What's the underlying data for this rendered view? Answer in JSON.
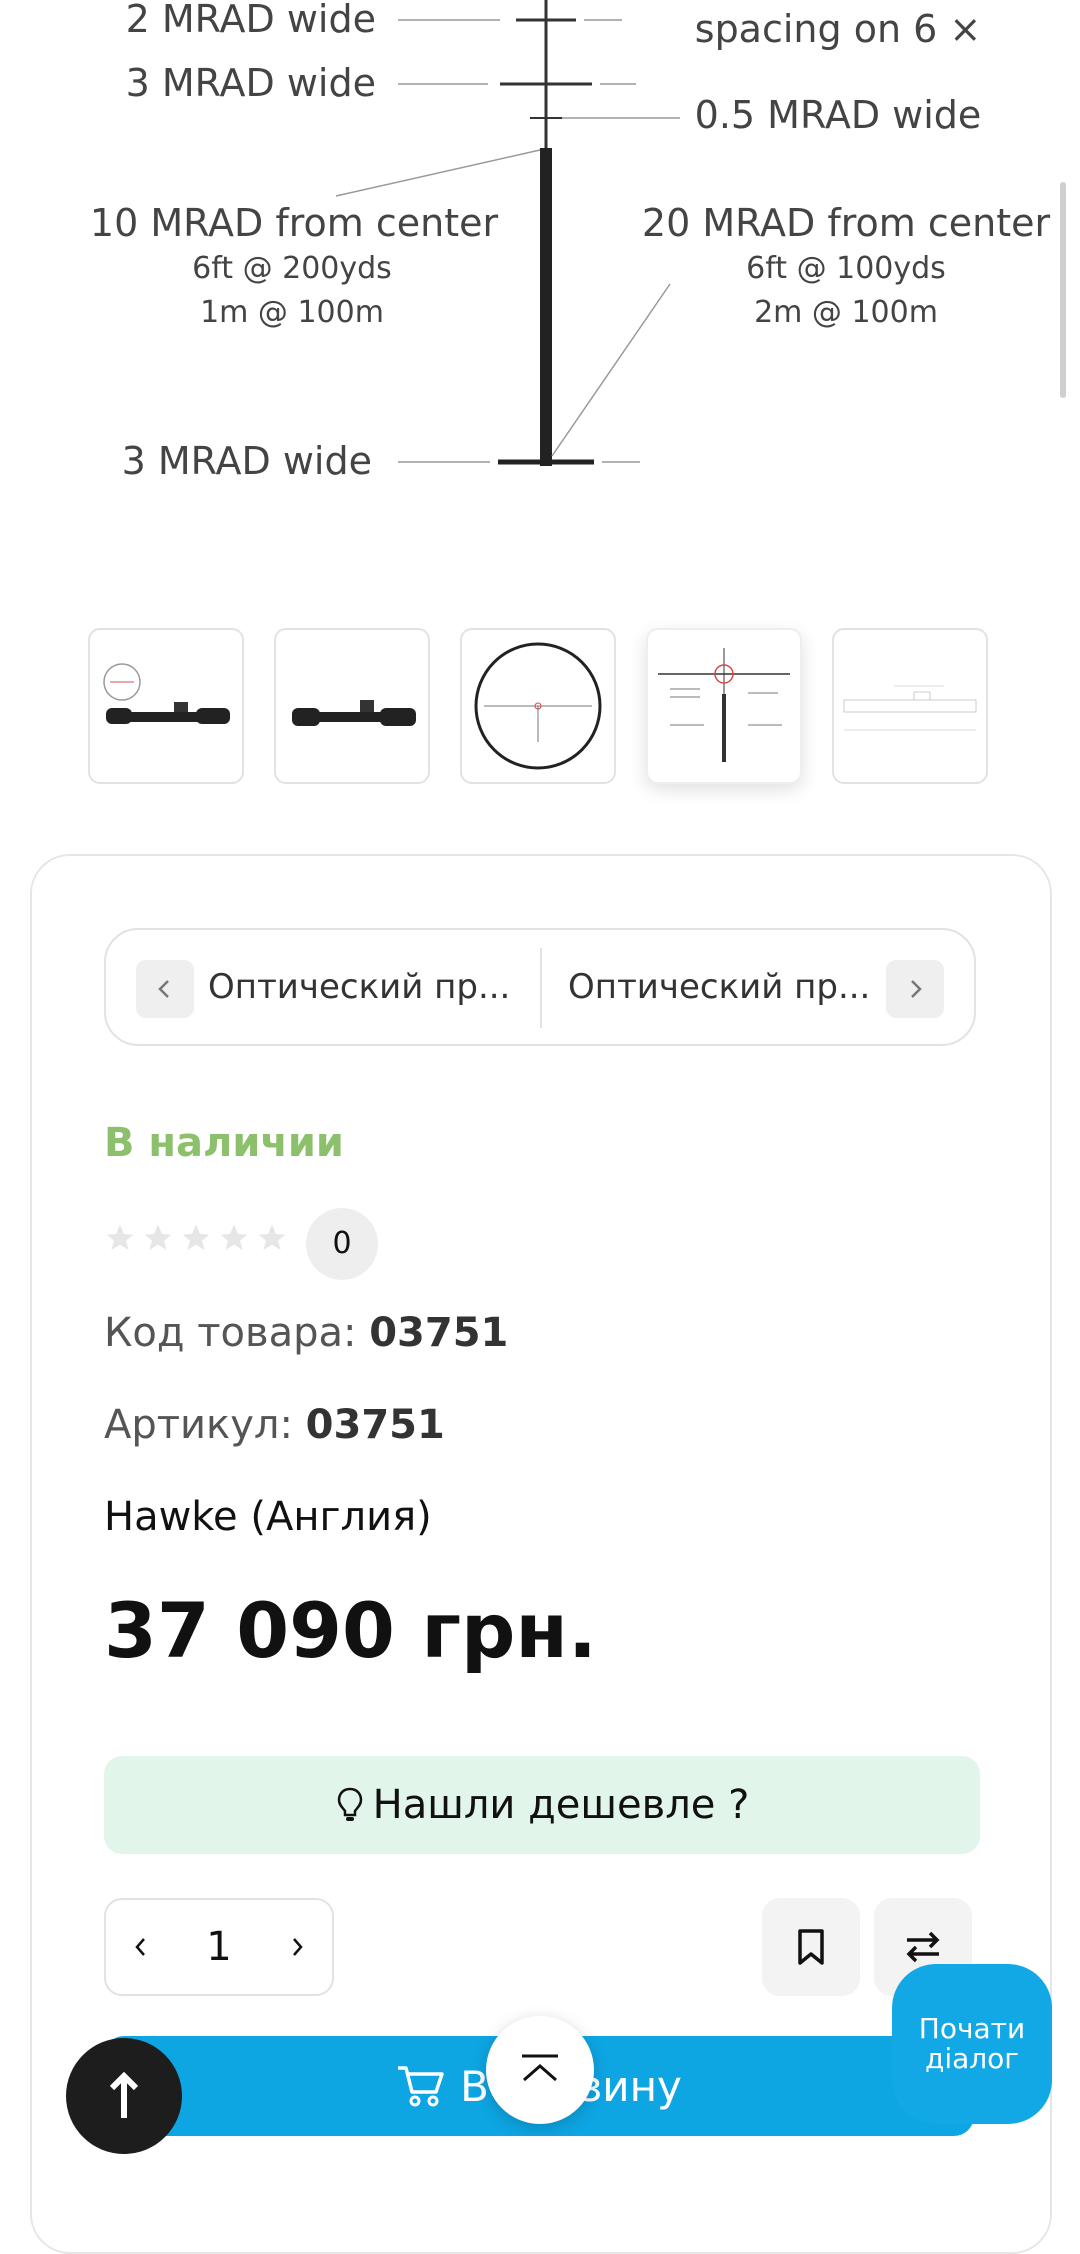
{
  "reticle": {
    "labels": {
      "two_mrad": "2 MRAD wide",
      "three_mrad_top": "3 MRAD wide",
      "spacing": "spacing on 6 ×",
      "half_mrad": "0.5 MRAD wide",
      "ten_mrad": "10 MRAD from center",
      "ten_sub1": "6ft @ 200yds",
      "ten_sub2": "1m @ 100m",
      "twenty_mrad": "20 MRAD from center",
      "twenty_sub1": "6ft @ 100yds",
      "twenty_sub2": "2m @ 100m",
      "three_mrad_bottom": "3 MRAD wide"
    }
  },
  "gallery": {
    "thumbnails": [
      {
        "icon": "scope-side-view-with-reticle"
      },
      {
        "icon": "scope-side-view"
      },
      {
        "icon": "reticle-circle"
      },
      {
        "icon": "reticle-diagram",
        "active": true
      },
      {
        "icon": "scope-dimensions-drawing"
      }
    ]
  },
  "product_nav": {
    "prev_label": "Оптический пр...",
    "next_label": "Оптический пр..."
  },
  "product": {
    "stock_status": "В наличии",
    "stock_color": "#8cc06c",
    "rating": 0,
    "rating_count": "0",
    "code_label": "Код товара:",
    "code_value": "03751",
    "article_label": "Артикул:",
    "article_value": "03751",
    "brand": "Hawke (Англия)",
    "price": "37 090 грн."
  },
  "actions": {
    "cheaper_label": "Нашли дешевле ?",
    "quantity": "1",
    "cart_label": "В корзину",
    "chat_label": "Почати\nдіалог",
    "accent_color": "#0ea5e3"
  }
}
